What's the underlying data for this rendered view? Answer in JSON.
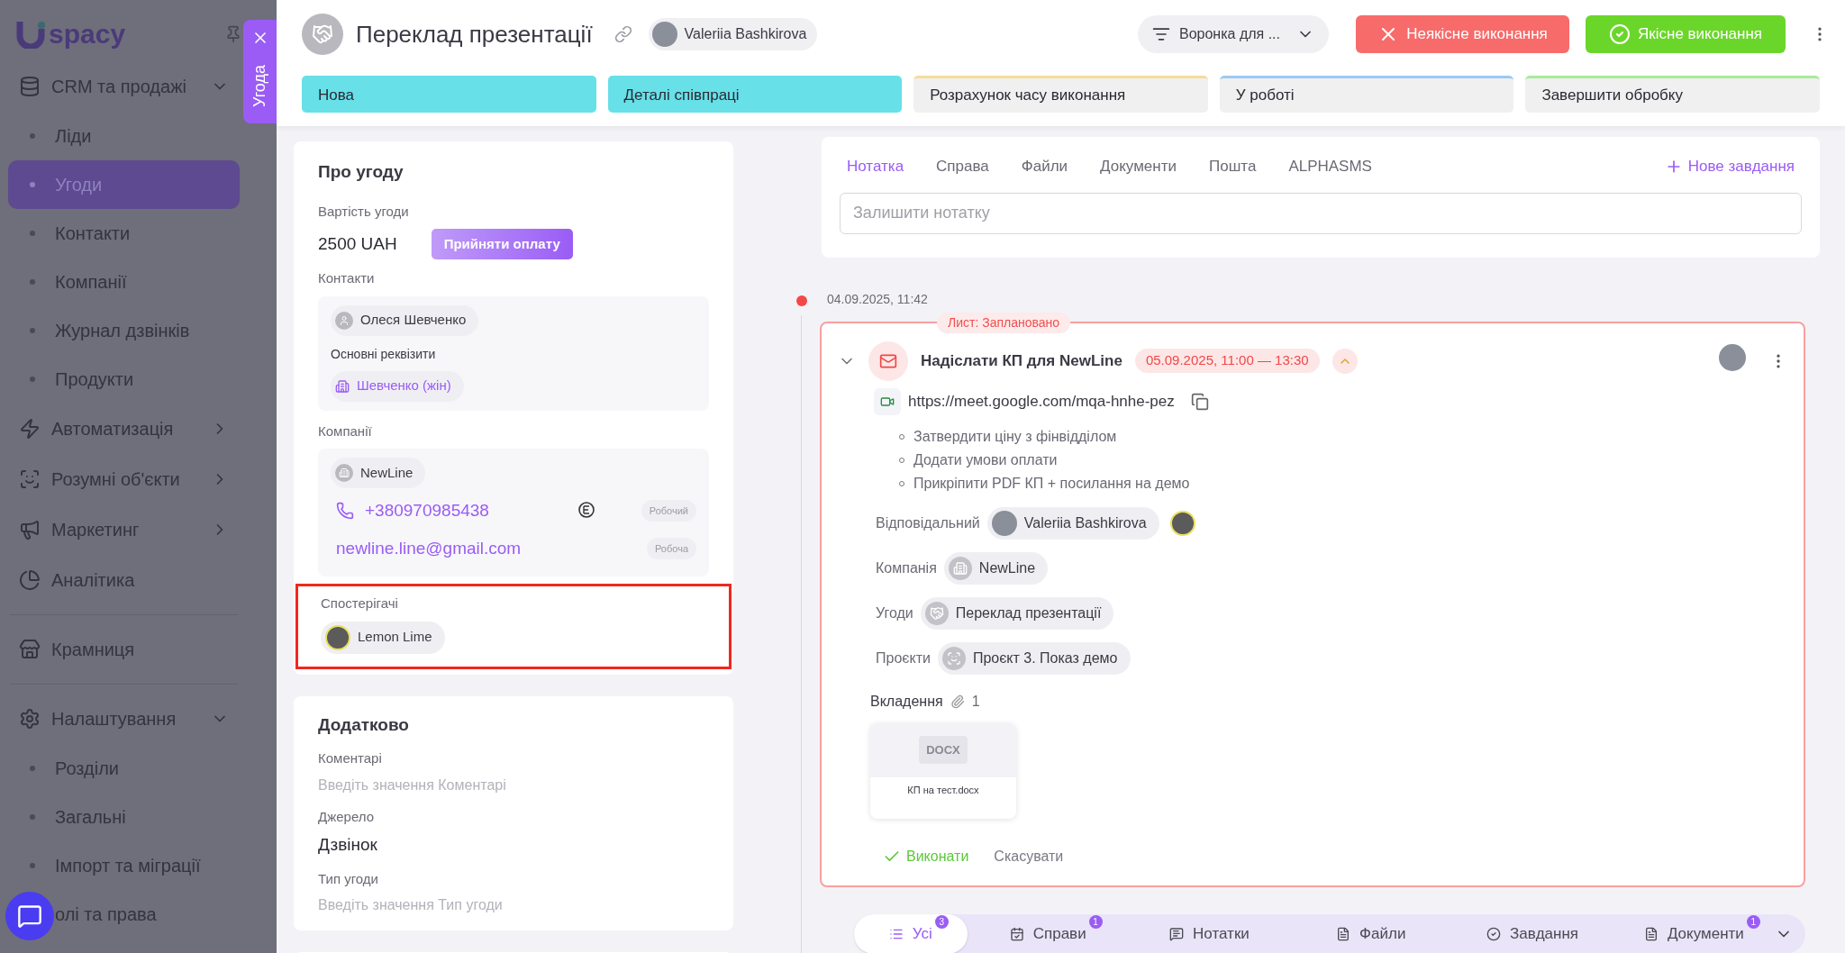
{
  "sidebar": {
    "logo_text": "spacy",
    "items": [
      {
        "label": "CRM та продажі",
        "expanded": true,
        "children": [
          {
            "label": "Ліди",
            "selected": false
          },
          {
            "label": "Угоди",
            "selected": true
          },
          {
            "label": "Контакти",
            "selected": false
          },
          {
            "label": "Компанії",
            "selected": false
          },
          {
            "label": "Журнал дзвінків",
            "selected": false
          },
          {
            "label": "Продукти",
            "selected": false
          }
        ]
      },
      {
        "label": "Автоматизація",
        "expanded": false
      },
      {
        "label": "Розумні об'єкти",
        "expanded": false
      },
      {
        "label": "Маркетинг",
        "expanded": false
      },
      {
        "label": "Аналітика"
      },
      {
        "label": "Крамниця"
      },
      {
        "label": "Налаштування",
        "expanded": true,
        "children": [
          {
            "label": "Розділи",
            "selected": false
          },
          {
            "label": "Загальні",
            "selected": false
          },
          {
            "label": "Імпорт та міграції",
            "selected": false
          },
          {
            "label": "олі та права",
            "selected": false
          }
        ]
      }
    ]
  },
  "drawer_tab": {
    "label": "Угода"
  },
  "header": {
    "title": "Переклад презентації",
    "owner": "Valeriia Bashkirova",
    "funnel": "Воронка для ...",
    "fail_button": "Неякісне виконання",
    "success_button": "Якісне виконання",
    "stages": [
      {
        "label": "Нова",
        "reached": true,
        "color": "#67e0e8"
      },
      {
        "label": "Деталі співпраці",
        "reached": true,
        "color": "#67e0e8"
      },
      {
        "label": "Розрахунок часу виконання",
        "reached": false,
        "color": "#f7dc9a"
      },
      {
        "label": "У роботі",
        "reached": false,
        "color": "#9ccaf2"
      },
      {
        "label": "Завершити обробку",
        "reached": false,
        "color": "#a8ea9c"
      }
    ]
  },
  "about": {
    "title": "Про угоду",
    "value_label": "Вартість угоди",
    "value": "2500 UAH",
    "pay_button": "Прийняти оплату",
    "contacts_label": "Контакти",
    "contact": "Олеся Шевченко",
    "requisites_label": "Основні реквізити",
    "requisite": "Шевченко (жін)",
    "companies_label": "Компанії",
    "company": {
      "name": "NewLine",
      "phone": "+380970985438",
      "phone_tag": "Робочий",
      "email": "newline.line@gmail.com",
      "email_tag": "Робоча"
    },
    "watchers": {
      "label": "Спостерігачі",
      "highlighted": true,
      "people": [
        "Lemon Lime"
      ]
    }
  },
  "extra": {
    "title": "Додатково",
    "fields": [
      {
        "label": "Коментарі",
        "placeholder": "Введіть значення Коментарі"
      },
      {
        "label": "Джерело",
        "value": "Дзвінок"
      },
      {
        "label": "Тип угоди",
        "placeholder": "Введіть значення Тип угоди"
      }
    ]
  },
  "composer": {
    "tabs": [
      {
        "label": "Нотатка",
        "selected": true
      },
      {
        "label": "Справа",
        "selected": false
      },
      {
        "label": "Файли",
        "selected": false
      },
      {
        "label": "Документи",
        "selected": false
      },
      {
        "label": "Пошта",
        "selected": false
      },
      {
        "label": "ALPHASMS",
        "selected": false
      }
    ],
    "new_task": "Нове завдання",
    "placeholder": "Залишити нотатку"
  },
  "timeline": {
    "date": "04.09.2025, 11:42",
    "event": {
      "status": "Лист: Заплановано",
      "expanded": true,
      "title": "Надіслати КП для NewLine",
      "time": "05.09.2025, 11:00 — 13:30",
      "link": "https://meet.google.com/mqa-hnhe-pez",
      "bullets": [
        "Затвердити ціну з фінвідділом",
        "Додати умови оплати",
        "Прикріпити PDF КП + посилання на демо"
      ],
      "relations": [
        {
          "label": "Відповідальний",
          "kind": "person",
          "value": "Valeriia Bashkirova",
          "extra_avatar": true
        },
        {
          "label": "Компанія",
          "kind": "company",
          "value": "NewLine"
        },
        {
          "label": "Угоди",
          "kind": "deal",
          "value": "Переклад презентації"
        },
        {
          "label": "Проєкти",
          "kind": "project",
          "value": "Проєкт 3. Показ демо"
        }
      ],
      "attachments_label": "Вкладення",
      "attachments_count": "1",
      "files": [
        {
          "type": "DOCX",
          "name": "КП на тест.docx"
        }
      ],
      "done_button": "Виконати",
      "cancel_button": "Скасувати"
    }
  },
  "filters": [
    {
      "label": "Усі",
      "count": "3",
      "selected": true
    },
    {
      "label": "Справи",
      "count": "1",
      "selected": false
    },
    {
      "label": "Нотатки",
      "selected": false
    },
    {
      "label": "Файли",
      "selected": false
    },
    {
      "label": "Завдання",
      "selected": false
    },
    {
      "label": "Документи",
      "count": "1",
      "selected": false
    }
  ]
}
